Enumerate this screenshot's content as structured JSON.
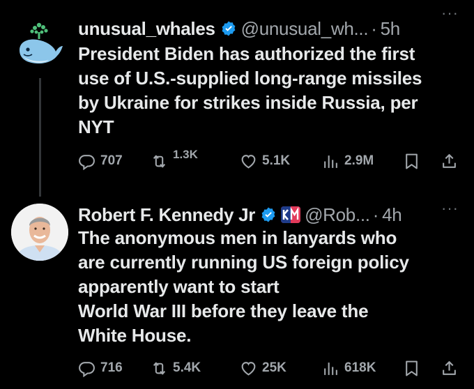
{
  "tweets": [
    {
      "author": {
        "display_name": "unusual_whales",
        "handle": "@unusual_wh...",
        "verified": true,
        "avatar_icon": "whale-icon"
      },
      "time": "5h",
      "text_lines": [
        "President Biden has authorized the first",
        "use of U.S.-supplied long-range missiles",
        "by Ukraine for strikes inside Russia, per",
        "NYT"
      ],
      "stats": {
        "replies": "707",
        "reposts": "1.3K",
        "likes": "5.1K",
        "views": "2.9M"
      }
    },
    {
      "author": {
        "display_name": "Robert F. Kennedy Jr",
        "handle": "@Rob...",
        "verified": true,
        "affiliate_badge": "KM",
        "avatar_icon": "profile-photo"
      },
      "time": "4h",
      "text_lines": [
        "The anonymous men in lanyards who",
        "are currently running US foreign policy",
        "apparently want to start",
        "World War III before they leave the",
        "White House."
      ],
      "stats": {
        "replies": "716",
        "reposts": "5.4K",
        "likes": "25K",
        "views": "618K"
      }
    }
  ],
  "ui": {
    "separator": "·",
    "more": "···"
  },
  "colors": {
    "background": "#000000",
    "primary_text": "#e7e9ea",
    "secondary_text": "#71767b",
    "verified_blue": "#1d9bf0",
    "whale_blue": "#8cc6ea",
    "whale_spout": "#4fbf7a"
  }
}
